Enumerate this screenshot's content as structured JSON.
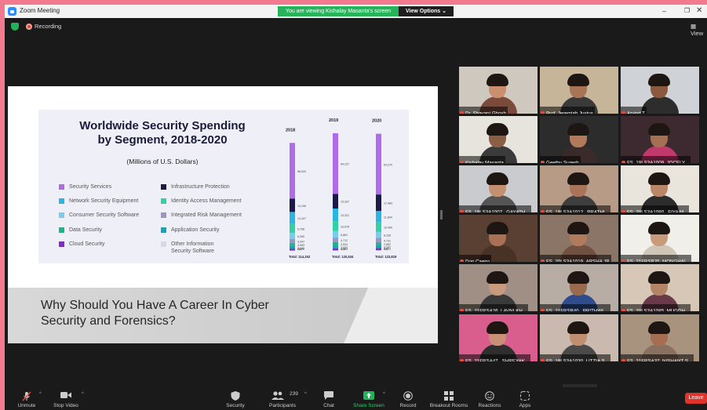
{
  "window": {
    "title": "Zoom Meeting",
    "share_banner": "You are viewing Kishalay Masanta's screen",
    "view_options": "View Options ⌄",
    "minimize": "–",
    "maximize": "❐",
    "close": "✕"
  },
  "status": {
    "recording": "Recording",
    "view": "View"
  },
  "slide": {
    "infographic_title_line1": "Worldwide Security Spending",
    "infographic_title_line2": "by Segment, 2018-2020",
    "infographic_subtitle": "(Millions of U.S. Dollars)",
    "legend": [
      {
        "label": "Security Services",
        "color": "#b06ce8"
      },
      {
        "label": "Network Security Equipment",
        "color": "#2ab5e3"
      },
      {
        "label": "Consumer Security Software",
        "color": "#76cdec"
      },
      {
        "label": "Data Security",
        "color": "#26b08a"
      },
      {
        "label": "Cloud Security",
        "color": "#7e2fc0"
      },
      {
        "label": "Infrastructure Protection",
        "color": "#1c1a49"
      },
      {
        "label": "Identity Access Management",
        "color": "#2fd2a6"
      },
      {
        "label": "Integrated Risk Management",
        "color": "#9a94c8"
      },
      {
        "label": "Application Security",
        "color": "#1aa3b6"
      },
      {
        "label": "Other Information Security Software",
        "color": "#d9d9e4"
      }
    ],
    "heading_line1": "Why Should You Have A Career In Cyber",
    "heading_line2": "Security and Forensics?"
  },
  "chart_data": {
    "type": "bar",
    "stacked": true,
    "categories": [
      "2018",
      "2019",
      "2020"
    ],
    "series": [
      {
        "name": "Security Services",
        "color": "#b06ce8",
        "values": [
          58920,
          64237,
          64270
        ]
      },
      {
        "name": "Infrastructure Protection",
        "color": "#1c1a49",
        "values": [
          14106,
          15337,
          17483
        ]
      },
      {
        "name": "Network Security Equipment",
        "color": "#2ab5e3",
        "values": [
          12427,
          13321,
          11694
        ]
      },
      {
        "name": "Identity Access Management",
        "color": "#2fd2a6",
        "values": [
          9768,
          10578,
          10409
        ]
      },
      {
        "name": "Consumer Security Software",
        "color": "#76cdec",
        "values": [
          6395,
          6881,
          6235
        ]
      },
      {
        "name": "Integrated Risk Management",
        "color": "#9a94c8",
        "values": [
          4347,
          4712,
          4731
        ]
      },
      {
        "name": "Data Security",
        "color": "#26b08a",
        "values": [
          3063,
          3524,
          2852
        ]
      },
      {
        "name": "Application Security",
        "color": "#1aa3b6",
        "values": [
          2742,
          3003,
          3287
        ]
      },
      {
        "name": "Cloud Security",
        "color": "#7e2fc0",
        "values": [
          2070,
          2285,
          2273
        ]
      },
      {
        "name": "Other Information Security Software",
        "color": "#d9d9e4",
        "values": [
          304,
          459,
          585
        ]
      }
    ],
    "totals": [
      "Total: 114,152",
      "Total: 120,534",
      "Total: 123,819"
    ],
    "value_labels": [
      [
        "58,920",
        "14,106",
        "12,427",
        "9,768",
        "6,395",
        "4,347",
        "3,063",
        "2,742",
        "2,070",
        "304"
      ],
      [
        "64,237",
        "15,337",
        "13,321",
        "10,578",
        "6,881",
        "4,712",
        "3,524",
        "3,003",
        "2,285",
        "459"
      ],
      [
        "64,270",
        "17,483",
        "11,694",
        "10,409",
        "6,235",
        "4,731",
        "2,852",
        "3,287",
        "2,273",
        "585"
      ]
    ]
  },
  "gallery": {
    "participants": [
      {
        "name": "Dr. Shayani Ghosh",
        "bg": "#cfc8bf",
        "skin": "#c98f6e",
        "shirt": "#7b4a3b"
      },
      {
        "name": "Prof. Jeremiah Justus",
        "bg": "#c7b59a",
        "skin": "#a87456",
        "shirt": "#3a3a3a"
      },
      {
        "name": "Arvind T",
        "bg": "#cfd3d8",
        "skin": "#8b5a3e",
        "shirt": "#2d2d2d"
      },
      {
        "name": "Kishalay Masanta",
        "bg": "#e7e4dd",
        "skin": "#8a5f45",
        "shirt": "#3b3b3b"
      },
      {
        "name": "Geethu Suresh",
        "bg": "#2c2c2c",
        "skin": "#b07a5b",
        "shirt": "#3a2a2a"
      },
      {
        "name": "FS_19LS3A1009_JOCELY...",
        "bg": "#3c2a30",
        "skin": "#a46f52",
        "shirt": "#c0386c"
      },
      {
        "name": "FS_19LS3A1007_ GAYATH...",
        "bg": "#c9cbcf",
        "skin": "#c4906f",
        "shirt": "#555555"
      },
      {
        "name": "FS_19LS3A1012_ PRATHI...",
        "bg": "#b89b86",
        "skin": "#a9745a",
        "shirt": "#3e3e3e"
      },
      {
        "name": "FS_20LS3A1080_ FIYA M...",
        "bg": "#e9e5dc",
        "skin": "#b98668",
        "shirt": "#2c2c2c"
      },
      {
        "name": "Don Caeiro",
        "bg": "#5a4033",
        "skin": "#a87054",
        "shirt": "#483226"
      },
      {
        "name": "FS_20LS3A1019_ARSHA JB",
        "bg": "#8a7566",
        "skin": "#b07b5c",
        "shirt": "#705040"
      },
      {
        "name": "FS_21FRSB35_MONGHAI...",
        "bg": "#f1efe9",
        "skin": "#c79a7c",
        "shirt": "#cfc6b8"
      },
      {
        "name": "FS_21FRSA26_LAVNI KH...",
        "bg": "#9f8f84",
        "skin": "#c89b7e",
        "shirt": "#3a3a3a"
      },
      {
        "name": "FS_21FRSB40_ PRITHWI ...",
        "bg": "#b7ada4",
        "skin": "#9a6a4e",
        "shirt": "#2f4c8c"
      },
      {
        "name": "FS_20LS3A1085_MUGDH...",
        "bg": "#d6c7b6",
        "skin": "#b58366",
        "shirt": "#6a3a4a"
      },
      {
        "name": "FS_21FRSA47_ SHREYAK...",
        "bg": "#d95e8e",
        "skin": "#c99077",
        "shirt": "#2e2e2e"
      },
      {
        "name": "FS_19LS3A1030_LITZIA S...",
        "bg": "#c9b9ae",
        "skin": "#c08f72",
        "shirt": "#4a4a4a"
      },
      {
        "name": "FS_21FRSA37_NISHANT S...",
        "bg": "#a8937f",
        "skin": "#a56e50",
        "shirt": "#8a7060"
      }
    ],
    "scroll_down": "⌄"
  },
  "toolbar": {
    "unmute": "Unmute",
    "stop_video": "Stop Video",
    "security": "Security",
    "participants": "Participants",
    "participants_count": "239",
    "chat": "Chat",
    "share_screen": "Share Screen",
    "record": "Record",
    "breakout_rooms": "Breakout Rooms",
    "reactions": "Reactions",
    "apps": "Apps",
    "leave": "Leave",
    "caret": "^"
  }
}
